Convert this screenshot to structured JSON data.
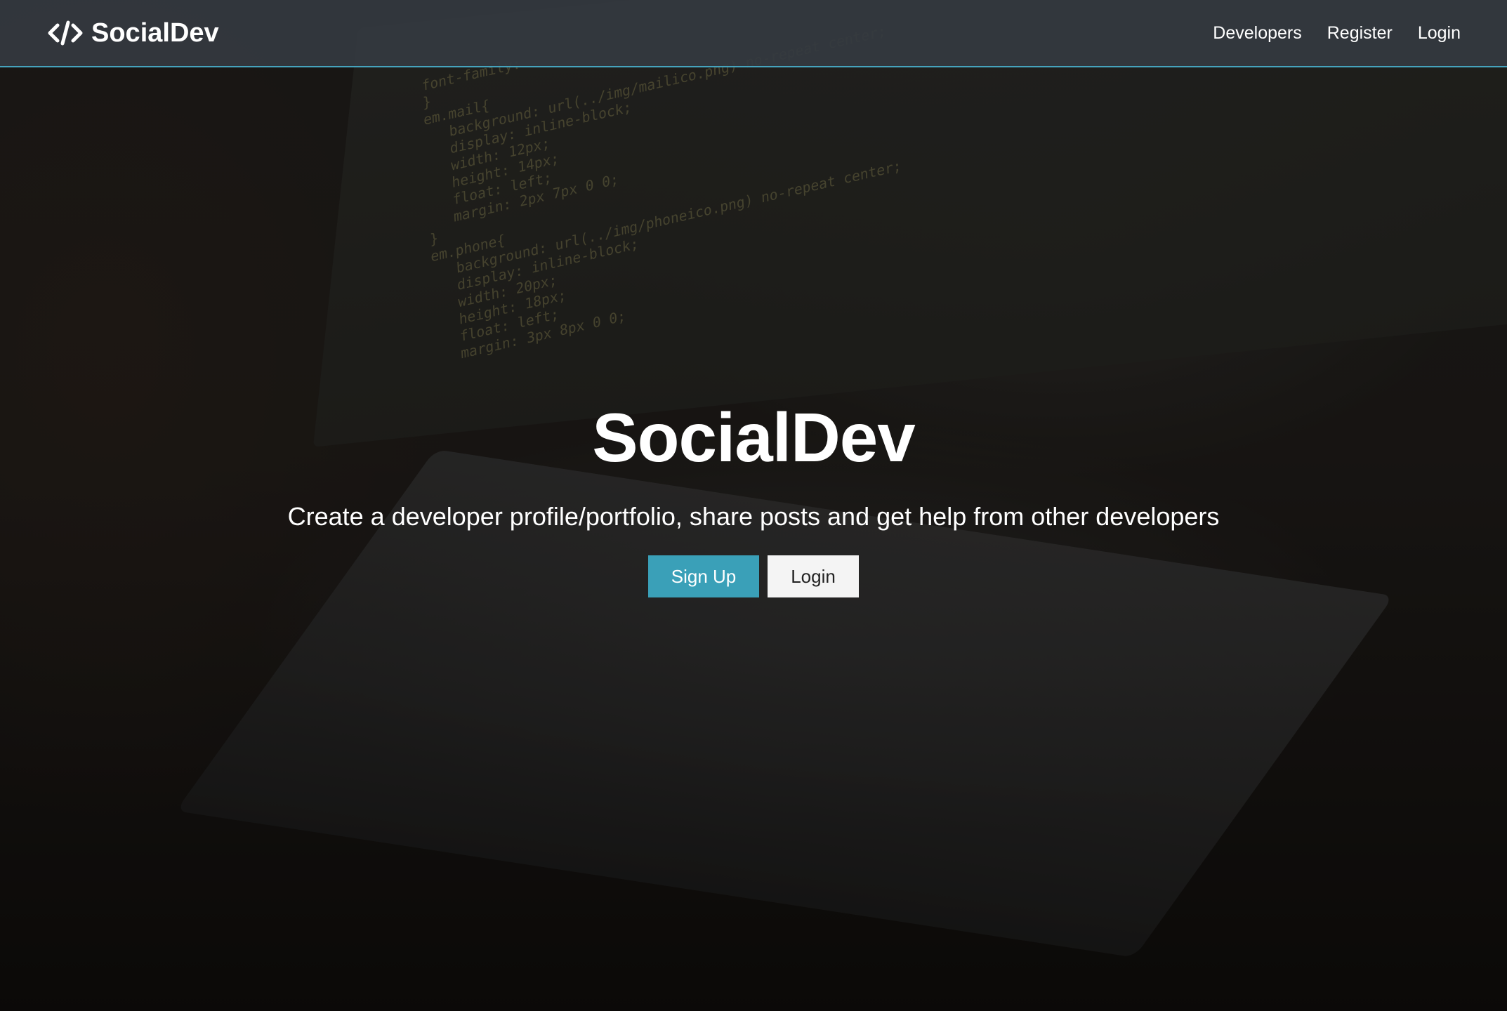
{
  "navbar": {
    "brand": "SocialDev",
    "brand_icon": "code-icon",
    "links": [
      {
        "label": "Developers"
      },
      {
        "label": "Register"
      },
      {
        "label": "Login"
      }
    ],
    "accent": "#45a3bd"
  },
  "hero": {
    "title": "SocialDev",
    "lead": "Create a developer profile/portfolio, share posts and get help from other developers",
    "signup_label": "Sign Up",
    "login_label": "Login",
    "primary_color": "#3aa0b8"
  },
  "background": {
    "code_lines": [
      "font-family:",
      "}",
      "em.mail{",
      "   background: url(../img/mailico.png) no-repeat center;",
      "   display: inline-block;",
      "   width: 12px;",
      "   height: 14px;",
      "   float: left;",
      "   margin: 2px 7px 0 0;",
      "}",
      "em.phone{",
      "   background: url(../img/phoneico.png) no-repeat center;",
      "   display: inline-block;",
      "   width: 20px;",
      "   height: 18px;",
      "   float: left;",
      "   margin: 3px 8px 0 0;"
    ]
  }
}
